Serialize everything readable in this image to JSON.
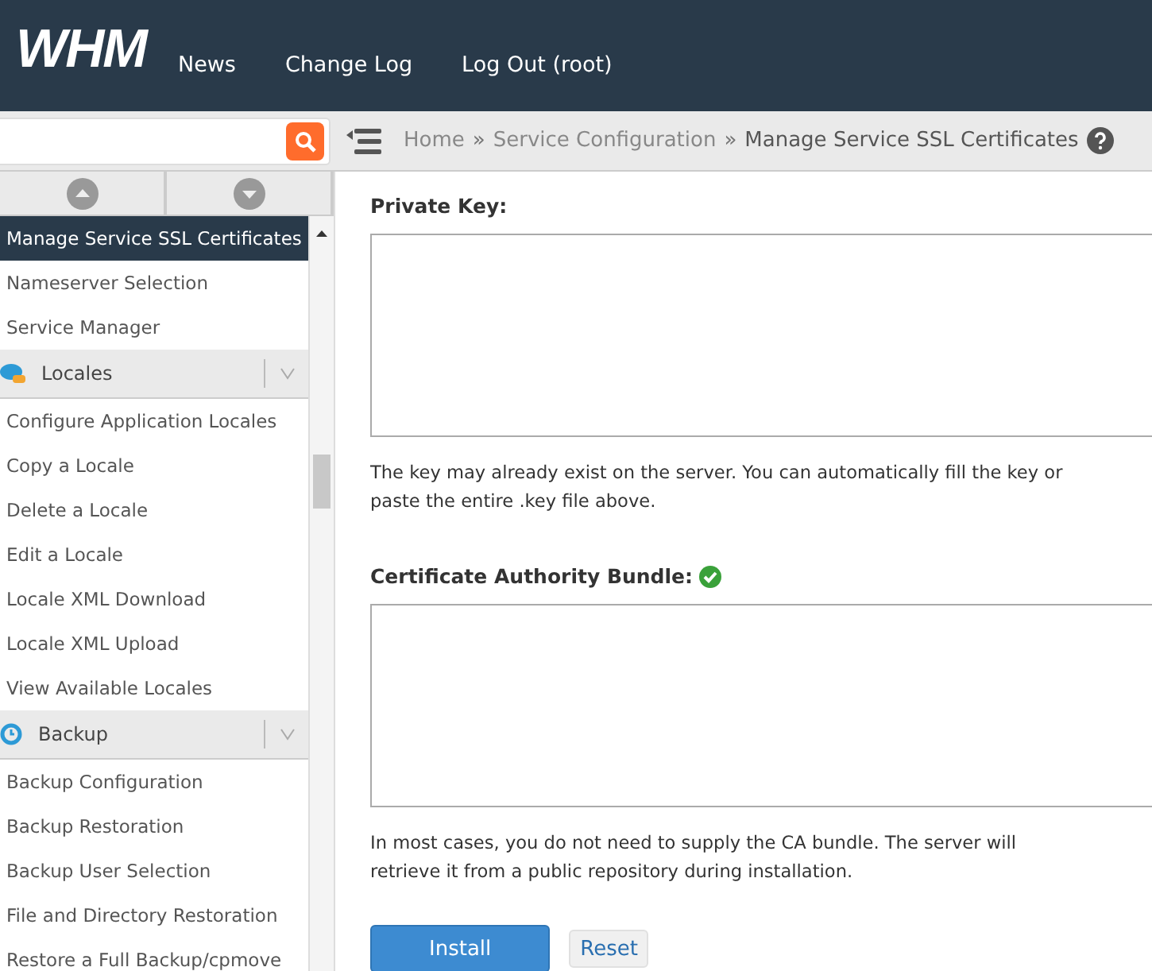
{
  "header": {
    "logo": "WHM",
    "nav": [
      "News",
      "Change Log",
      "Log Out (root)"
    ]
  },
  "breadcrumb": {
    "items": [
      "Home",
      "Service Configuration"
    ],
    "separator": "»",
    "current": "Manage Service SSL Certificates"
  },
  "sidebar": {
    "items": [
      {
        "kind": "item",
        "label": "Manage Service SSL Certificates",
        "selected": true
      },
      {
        "kind": "item",
        "label": "Nameserver Selection",
        "selected": false
      },
      {
        "kind": "item",
        "label": "Service Manager",
        "selected": false
      },
      {
        "kind": "section",
        "label": "Locales",
        "expanded": true
      },
      {
        "kind": "item",
        "label": "Configure Application Locales",
        "selected": false
      },
      {
        "kind": "item",
        "label": "Copy a Locale",
        "selected": false
      },
      {
        "kind": "item",
        "label": "Delete a Locale",
        "selected": false
      },
      {
        "kind": "item",
        "label": "Edit a Locale",
        "selected": false
      },
      {
        "kind": "item",
        "label": "Locale XML Download",
        "selected": false
      },
      {
        "kind": "item",
        "label": "Locale XML Upload",
        "selected": false
      },
      {
        "kind": "item",
        "label": "View Available Locales",
        "selected": false
      },
      {
        "kind": "section",
        "label": "Backup",
        "expanded": true
      },
      {
        "kind": "item",
        "label": "Backup Configuration",
        "selected": false
      },
      {
        "kind": "item",
        "label": "Backup Restoration",
        "selected": false
      },
      {
        "kind": "item",
        "label": "Backup User Selection",
        "selected": false
      },
      {
        "kind": "item",
        "label": "File and Directory Restoration",
        "selected": false
      },
      {
        "kind": "item",
        "label": "Restore a Full Backup/cpmove",
        "selected": false
      }
    ]
  },
  "form": {
    "fields": [
      {
        "label": "Private Key:",
        "valid": false,
        "hint": [
          "The key may already exist on the server. You can automatically fill the key or",
          "paste the entire .key file above."
        ]
      },
      {
        "label": "Certificate Authority Bundle:",
        "valid": true,
        "hint": [
          "In most cases, you do not need to supply the CA bundle. The server will",
          "retrieve it from a public repository during installation."
        ]
      }
    ],
    "buttons": [
      {
        "kind": "primary",
        "label": "Install"
      },
      {
        "kind": "secondary",
        "label": "Reset"
      }
    ]
  }
}
